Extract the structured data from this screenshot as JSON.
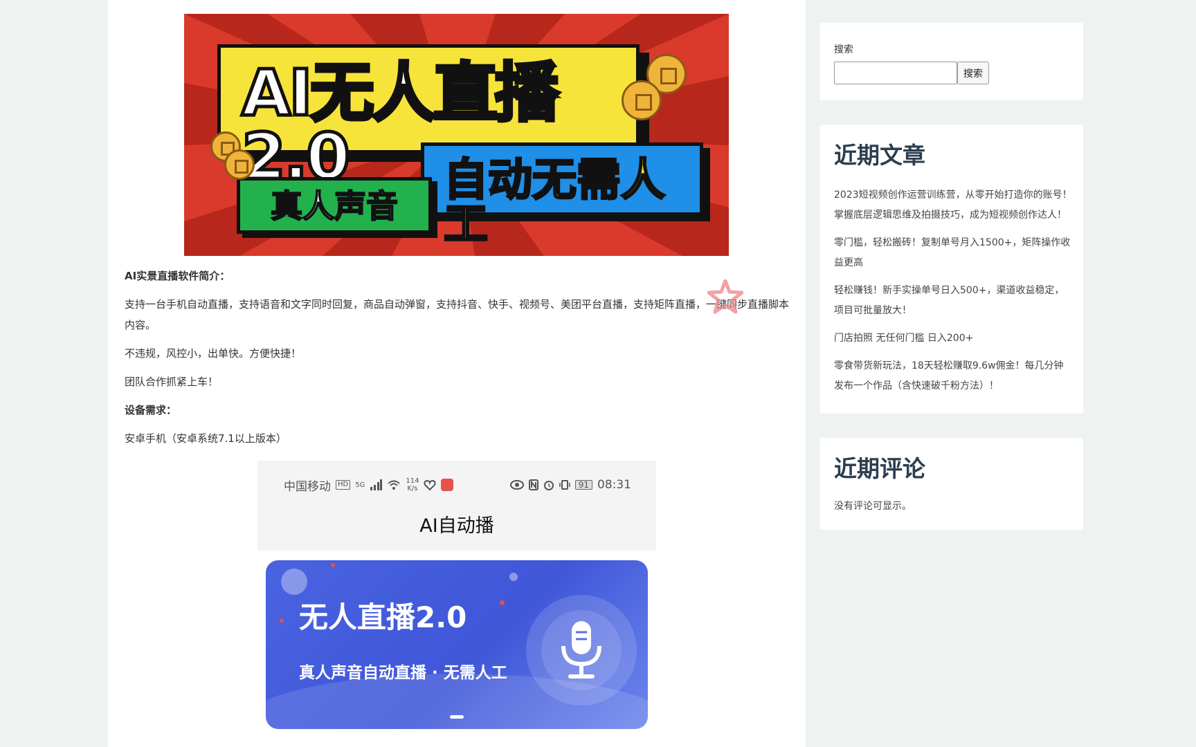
{
  "hero": {
    "title": "AI无人直播2.0",
    "tag_right": "自动无需人工",
    "tag_left": "真人声音"
  },
  "article": {
    "intro_heading": "AI实景直播软件简介：",
    "intro_text": "支持一台手机自动直播，支持语音和文字同时回复，商品自动弹窗，支持抖音、快手、视频号、美团平台直播，支持矩阵直播，一键同步直播脚本内容。",
    "line2": "不违规，风控小，出单快。方便快捷！",
    "line3": "团队合作抓紧上车！",
    "req_heading": "设备需求：",
    "req_text": "安卓手机（安卓系统7.1以上版本）"
  },
  "phone": {
    "carrier": "中国移动",
    "hd": "HD",
    "net": "5G",
    "speed": "114\nK/s",
    "battery": "91",
    "time": "08:31",
    "title": "AI自动播"
  },
  "banner": {
    "title": "无人直播2.0",
    "subtitle": "真人声音自动直播 · 无需人工"
  },
  "sidebar": {
    "search_label": "搜索",
    "search_placeholder": "",
    "search_button": "搜索",
    "recent_posts_title": "近期文章",
    "recent_posts": [
      "2023短视频创作运营训练营，从零开始打造你的账号！掌握底层逻辑思维及拍摄技巧，成为短视频创作达人！",
      "零门槛，轻松搬砖！复制单号月入1500+，矩阵操作收益更高",
      "轻松赚钱！新手实操单号日入500+，渠道收益稳定，项目可批量放大！",
      "门店拍照 无任何门槛 日入200+",
      "零食带货新玩法，18天轻松赚取9.6w佣金！每几分钟发布一个作品（含快速破千粉方法）！"
    ],
    "recent_comments_title": "近期评论",
    "no_comments": "没有评论可显示。"
  },
  "colors": {
    "page_bg": "#eef3f2",
    "hero_red": "#d93a2b",
    "hero_yellow": "#f7e43a",
    "hero_blue": "#1f8fe8",
    "hero_green": "#23b14d",
    "banner_blue": "#4a63e0",
    "widget_title": "#2c3e50"
  }
}
